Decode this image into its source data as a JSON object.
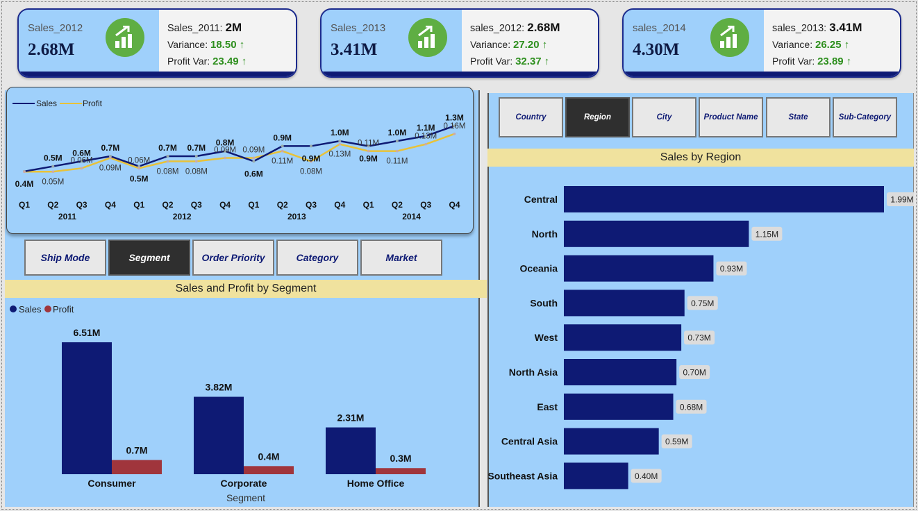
{
  "kpis": [
    {
      "label": "Sales_2012",
      "value": "2.68M",
      "prev_label": "Sales_2011: ",
      "prev_value": "2M",
      "variance_label": "Variance: ",
      "variance_value": "18.50 ↑",
      "profit_label": "Profit Var: ",
      "profit_value": "23.49 ↑"
    },
    {
      "label": "Sales_2013",
      "value": "3.41M",
      "prev_label": "sales_2012: ",
      "prev_value": "2.68M",
      "variance_label": "Variance: ",
      "variance_value": "27.20 ↑",
      "profit_label": "Profit Var: ",
      "profit_value": "32.37 ↑"
    },
    {
      "label": "sales_2014",
      "value": "4.30M",
      "prev_label": "sales_2013: ",
      "prev_value": "3.41M",
      "variance_label": "Variance: ",
      "variance_value": "26.25 ↑",
      "profit_label": "Profit Var: ",
      "profit_value": "23.89 ↑"
    }
  ],
  "kpi_icon": "bar-chart-growth-icon",
  "colors": {
    "navy": "#0e1a74",
    "gold": "#e8c238",
    "maroon": "#a0353c",
    "panel": "#9fd0fb",
    "band": "#f0e29e",
    "green": "#5fae43"
  },
  "left_slicers": {
    "buttons": [
      "Ship Mode",
      "Segment",
      "Order Priority",
      "Category",
      "Market"
    ],
    "selected": "Segment"
  },
  "right_slicers": {
    "buttons": [
      "Country",
      "Region",
      "City",
      "Product Name",
      "State",
      "Sub-Category"
    ],
    "selected": "Region"
  },
  "segment_title": "Sales and Profit by Segment",
  "region_title": "Sales by Region",
  "chart_data": [
    {
      "type": "line",
      "legend": [
        "Sales",
        "Profit"
      ],
      "x": [
        "Q1",
        "Q2",
        "Q3",
        "Q4",
        "Q1",
        "Q2",
        "Q3",
        "Q4",
        "Q1",
        "Q2",
        "Q3",
        "Q4",
        "Q1",
        "Q2",
        "Q3",
        "Q4"
      ],
      "years": [
        "2011",
        "2012",
        "2013",
        "2014"
      ],
      "series": [
        {
          "name": "Sales",
          "values": [
            0.4,
            0.5,
            0.6,
            0.7,
            0.5,
            0.7,
            0.7,
            0.8,
            0.6,
            0.9,
            0.9,
            1.0,
            0.9,
            1.0,
            1.1,
            1.3
          ],
          "labels": [
            "0.4M",
            "0.5M",
            "0.6M",
            "0.7M",
            "0.5M",
            "0.7M",
            "0.7M",
            "0.8M",
            "0.6M",
            "0.9M",
            "0.9M",
            "1.0M",
            "0.9M",
            "1.0M",
            "1.1M",
            "1.3M"
          ]
        },
        {
          "name": "Profit",
          "values": [
            0.05,
            0.05,
            0.06,
            0.09,
            0.06,
            0.08,
            0.08,
            0.09,
            0.09,
            0.11,
            0.08,
            0.13,
            0.11,
            0.11,
            0.13,
            0.16
          ],
          "labels": [
            "",
            "0.05M",
            "0.06M",
            "0.09M",
            "0.06M",
            "0.08M",
            "0.08M",
            "0.09M",
            "0.09M",
            "0.11M",
            "0.08M",
            "0.13M",
            "0.11M",
            "0.11M",
            "0.13M",
            "0.16M"
          ]
        }
      ]
    },
    {
      "type": "bar",
      "legend": [
        "Sales",
        "Profit"
      ],
      "xlabel": "Segment",
      "categories": [
        "Consumer",
        "Corporate",
        "Home Office"
      ],
      "series": [
        {
          "name": "Sales",
          "values": [
            6.51,
            3.82,
            2.31
          ],
          "labels": [
            "6.51M",
            "3.82M",
            "2.31M"
          ]
        },
        {
          "name": "Profit",
          "values": [
            0.7,
            0.4,
            0.3
          ],
          "labels": [
            "0.7M",
            "0.4M",
            "0.3M"
          ]
        }
      ]
    },
    {
      "type": "bar",
      "orientation": "horizontal",
      "categories": [
        "Central",
        "North",
        "Oceania",
        "South",
        "West",
        "North Asia",
        "East",
        "Central Asia",
        "Southeast Asia"
      ],
      "values": [
        1.99,
        1.15,
        0.93,
        0.75,
        0.73,
        0.7,
        0.68,
        0.59,
        0.4
      ],
      "labels": [
        "1.99M",
        "1.15M",
        "0.93M",
        "0.75M",
        "0.73M",
        "0.70M",
        "0.68M",
        "0.59M",
        "0.40M"
      ]
    }
  ]
}
